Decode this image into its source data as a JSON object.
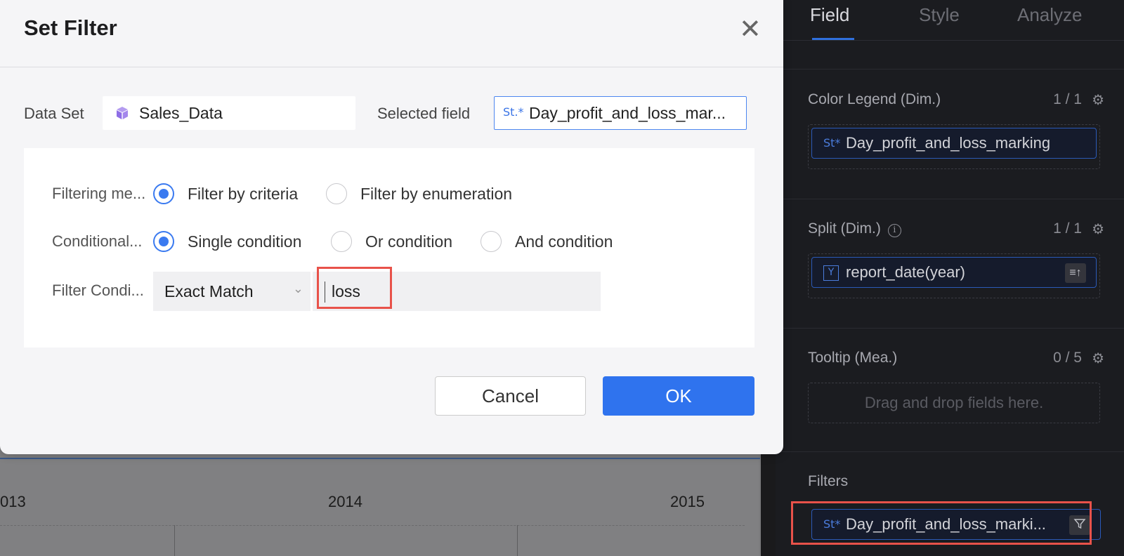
{
  "dialog": {
    "title": "Set Filter",
    "dataset_label": "Data Set",
    "dataset_value": "Sales_Data",
    "selected_field_label": "Selected field",
    "selected_field_value": "Day_profit_and_loss_mar...",
    "field_type_glyph": "St.*",
    "filtering_method_label": "Filtering me...",
    "filtering_methods": [
      "Filter by criteria",
      "Filter by enumeration"
    ],
    "filtering_method_selected": "Filter by criteria",
    "conditional_label": "Conditional...",
    "conditions": [
      "Single condition",
      "Or condition",
      "And condition"
    ],
    "condition_selected": "Single condition",
    "filter_condition_label": "Filter Condi...",
    "match_type": "Exact Match",
    "match_value": "loss",
    "cancel_label": "Cancel",
    "ok_label": "OK"
  },
  "panel": {
    "tabs": [
      "Field",
      "Style",
      "Analyze"
    ],
    "active_tab": "Field",
    "color_legend": {
      "title": "Color Legend (Dim.)",
      "count": "1 / 1",
      "field": "Day_profit_and_loss_marking"
    },
    "split": {
      "title": "Split (Dim.)",
      "count": "1 / 1",
      "field": "report_date(year)",
      "field_icon": "Y"
    },
    "tooltip": {
      "title": "Tooltip (Mea.)",
      "count": "0 / 5",
      "hint": "Drag and drop fields here."
    },
    "filters": {
      "title": "Filters",
      "field": "Day_profit_and_loss_marki..."
    }
  },
  "chart_axis": {
    "years": [
      "013",
      "2014",
      "2015"
    ]
  },
  "colors": {
    "accent": "#2f73ee",
    "highlight": "#e8524a",
    "panel_bg": "#1b1c20"
  },
  "icons": [
    "close-icon",
    "dataset-cube-icon",
    "string-field-icon",
    "chevron-down-icon",
    "gear-icon",
    "info-icon",
    "year-date-icon",
    "sort-icon",
    "filter-funnel-icon"
  ]
}
